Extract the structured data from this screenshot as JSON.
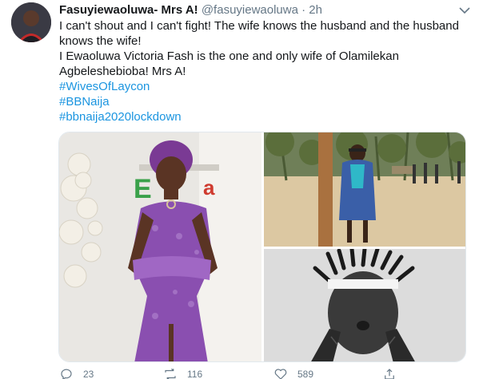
{
  "tweet": {
    "author_name": "Fasuyiewaoluwa- Mrs A!",
    "handle": "@fasuyiewaoluwa",
    "separator": "·",
    "time": "2h",
    "lines": [
      "I can't shout and I can't fight! The wife knows the husband and the husband knows the wife!",
      "I Ewaoluwa Victoria Fash is the one and only wife of Olamilekan Agbeleshebioba! Mrs A!"
    ],
    "hashtags": [
      "#WivesOfLaycon",
      "#BBNaija",
      "#bbnaija2020lockdown"
    ],
    "media_icons": [
      "photo-woman-purple-dress",
      "photo-woman-beach",
      "photo-man-headband-bw"
    ],
    "actions": {
      "reply_count": "23",
      "retweet_count": "116",
      "like_count": "589"
    },
    "colors": {
      "link": "#1b95e0",
      "muted": "#657786",
      "text": "#14171a"
    }
  }
}
